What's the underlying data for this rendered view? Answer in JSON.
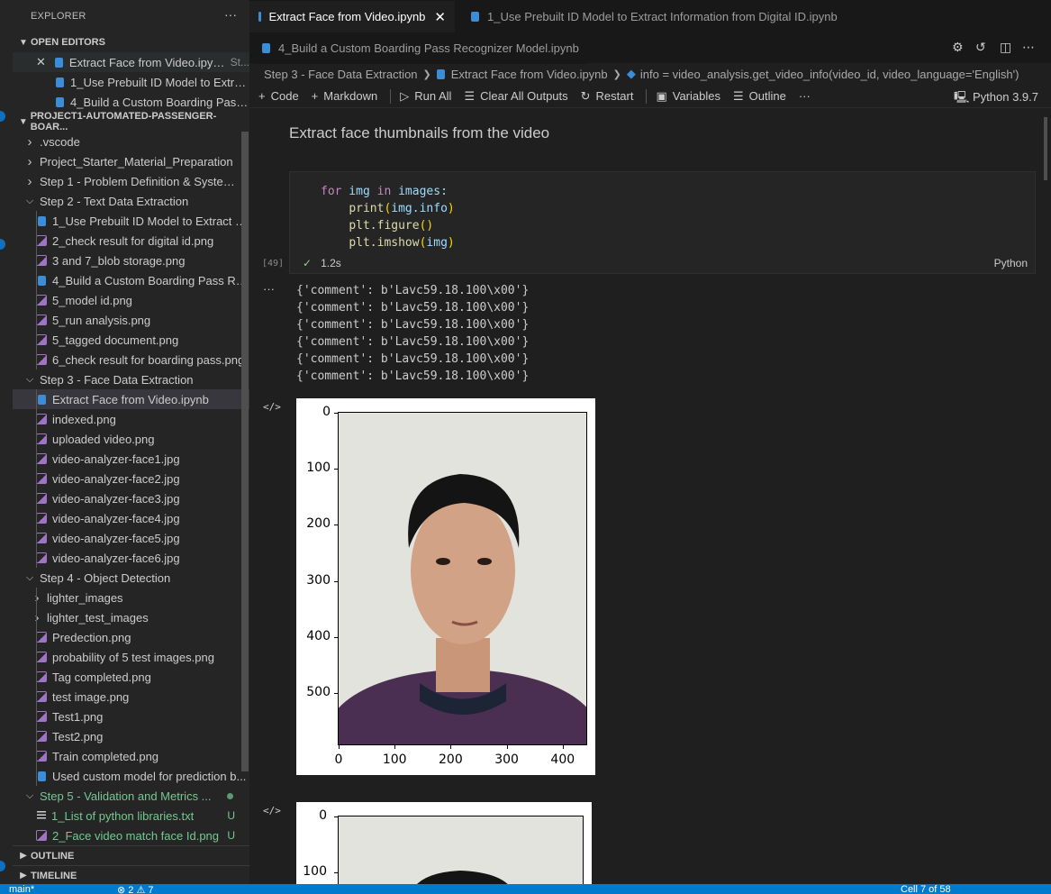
{
  "sidebar": {
    "title": "EXPLORER",
    "more": "···",
    "open_editors": {
      "label": "OPEN EDITORS",
      "items": [
        {
          "label": "Extract Face from Video.ipynb",
          "suffix": "St..."
        },
        {
          "label": "1_Use Prebuilt ID Model to Extra..."
        },
        {
          "label": "4_Build a Custom Boarding Pass ..."
        }
      ]
    },
    "project": {
      "label": "PROJECT1-AUTOMATED-PASSENGER-BOAR...",
      "items": [
        {
          "label": ".vscode",
          "type": "folder",
          "expanded": false
        },
        {
          "label": "Project_Starter_Material_Preparation",
          "type": "folder",
          "expanded": false
        },
        {
          "label": "Step 1 - Problem Definition & System ...",
          "type": "folder",
          "expanded": false
        },
        {
          "label": "Step 2 - Text Data Extraction",
          "type": "folder",
          "expanded": true
        },
        {
          "label": "1_Use Prebuilt ID Model to Extract In...",
          "type": "notebook"
        },
        {
          "label": "2_check result for digital id.png",
          "type": "image"
        },
        {
          "label": "3 and 7_blob storage.png",
          "type": "image"
        },
        {
          "label": "4_Build a Custom Boarding Pass Rec...",
          "type": "notebook"
        },
        {
          "label": "5_model id.png",
          "type": "image"
        },
        {
          "label": "5_run analysis.png",
          "type": "image"
        },
        {
          "label": "5_tagged document.png",
          "type": "image"
        },
        {
          "label": "6_check result for boarding pass.png",
          "type": "image"
        },
        {
          "label": "Step 3 - Face Data Extraction",
          "type": "folder",
          "expanded": true
        },
        {
          "label": "Extract Face from Video.ipynb",
          "type": "notebook",
          "active": true
        },
        {
          "label": "indexed.png",
          "type": "image"
        },
        {
          "label": "uploaded video.png",
          "type": "image"
        },
        {
          "label": "video-analyzer-face1.jpg",
          "type": "image"
        },
        {
          "label": "video-analyzer-face2.jpg",
          "type": "image"
        },
        {
          "label": "video-analyzer-face3.jpg",
          "type": "image"
        },
        {
          "label": "video-analyzer-face4.jpg",
          "type": "image"
        },
        {
          "label": "video-analyzer-face5.jpg",
          "type": "image"
        },
        {
          "label": "video-analyzer-face6.jpg",
          "type": "image"
        },
        {
          "label": "Step 4 - Object Detection",
          "type": "folder",
          "expanded": true
        },
        {
          "label": "lighter_images",
          "type": "folder",
          "expanded": false
        },
        {
          "label": "lighter_test_images",
          "type": "folder",
          "expanded": false
        },
        {
          "label": "Predection.png",
          "type": "image"
        },
        {
          "label": "probability of 5 test images.png",
          "type": "image"
        },
        {
          "label": "Tag completed.png",
          "type": "image"
        },
        {
          "label": "test image.png",
          "type": "image"
        },
        {
          "label": "Test1.png",
          "type": "image"
        },
        {
          "label": "Test2.png",
          "type": "image"
        },
        {
          "label": "Train completed.png",
          "type": "image"
        },
        {
          "label": "Used custom model for prediction b...",
          "type": "notebook"
        },
        {
          "label": "Step 5 - Validation and Metrics ...",
          "type": "folder",
          "expanded": true,
          "git": "dot"
        },
        {
          "label": "1_List of python libraries.txt",
          "type": "text",
          "git": "U"
        },
        {
          "label": "2_Face video match face Id.png",
          "type": "image",
          "git": "U"
        }
      ]
    },
    "outline": "OUTLINE",
    "timeline": "TIMELINE"
  },
  "tabs": [
    {
      "label": "Extract Face from Video.ipynb",
      "active": true,
      "close": "✕"
    },
    {
      "label": "1_Use Prebuilt ID Model to Extract Information from Digital ID.ipynb"
    },
    {
      "label": "4_Build a Custom Boarding Pass Recognizer Model.ipynb"
    }
  ],
  "breadcrumb": {
    "folder": "Step 3 - Face Data Extraction",
    "file": "Extract Face from Video.ipynb",
    "symbol": "info = video_analysis.get_video_info(video_id, video_language='English')"
  },
  "toolbar": {
    "code": "Code",
    "markdown": "Markdown",
    "run_all": "Run All",
    "clear": "Clear All Outputs",
    "restart": "Restart",
    "variables": "Variables",
    "outline": "Outline",
    "more": "···",
    "kernel": "Python 3.9.7"
  },
  "notebook": {
    "markdown_text": "Extract face thumbnails from the video",
    "cell": {
      "exec_count": "[49]",
      "duration": "1.2s",
      "language": "Python",
      "code": [
        {
          "kw": "for",
          "a": " img ",
          "kw2": "in",
          "b": " images:"
        },
        {
          "fn": "print",
          "args": "img.info"
        },
        {
          "fn": "plt.figure",
          "args": ""
        },
        {
          "fn": "plt.imshow",
          "args": "img"
        }
      ]
    },
    "output_lines": [
      "{'comment': b'Lavc59.18.100\\x00'}",
      "{'comment': b'Lavc59.18.100\\x00'}",
      "{'comment': b'Lavc59.18.100\\x00'}",
      "{'comment': b'Lavc59.18.100\\x00'}",
      "{'comment': b'Lavc59.18.100\\x00'}",
      "{'comment': b'Lavc59.18.100\\x00'}"
    ],
    "plot1": {
      "yticks": [
        "0",
        "100",
        "200",
        "300",
        "400",
        "500"
      ],
      "xticks": [
        "0",
        "100",
        "200",
        "300",
        "400"
      ]
    },
    "plot2": {
      "yticks": [
        "0",
        "100"
      ]
    }
  },
  "status": {
    "branch": "main*",
    "errors": "⊗ 2 ⚠ 7",
    "cell": "Cell 7 of 58"
  },
  "colors": {
    "accent": "#007acc",
    "git_untracked": "#73c991",
    "notebook_icon": "#3c8dd8",
    "image_icon": "#a074c4"
  }
}
